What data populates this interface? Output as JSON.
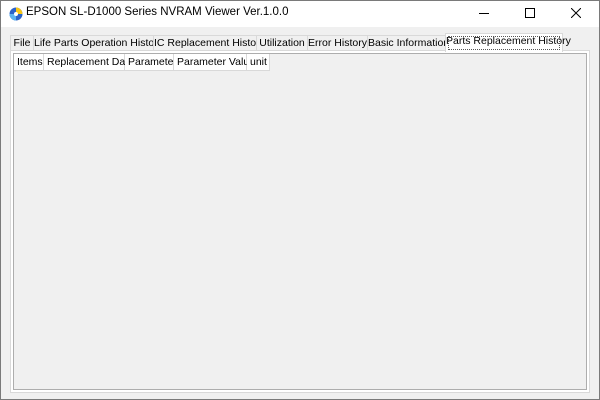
{
  "window": {
    "title": "EPSON SL-D1000 Series NVRAM Viewer  Ver.1.0.0",
    "icon": "epson-app-icon",
    "controls": {
      "minimize_icon": "minimize-icon",
      "maximize_icon": "maximize-icon",
      "close_icon": "close-icon"
    }
  },
  "tabs": [
    {
      "label": "File"
    },
    {
      "label": "Life Parts Operation History"
    },
    {
      "label": "IC Replacement History"
    },
    {
      "label": "Utilization"
    },
    {
      "label": "Error History"
    },
    {
      "label": "Basic Information"
    },
    {
      "label": "Parts Replacement History"
    }
  ],
  "active_tab": "Parts Replacement History",
  "grid": {
    "columns": [
      {
        "label": "Items"
      },
      {
        "label": "Replacement Date"
      },
      {
        "label": "Parameter"
      },
      {
        "label": "Parameter Value"
      },
      {
        "label": "unit"
      }
    ],
    "rows": []
  },
  "colors": {
    "background": "#f0f0f0",
    "header_bg": "#ffffff",
    "border": "#d9d9d9"
  }
}
